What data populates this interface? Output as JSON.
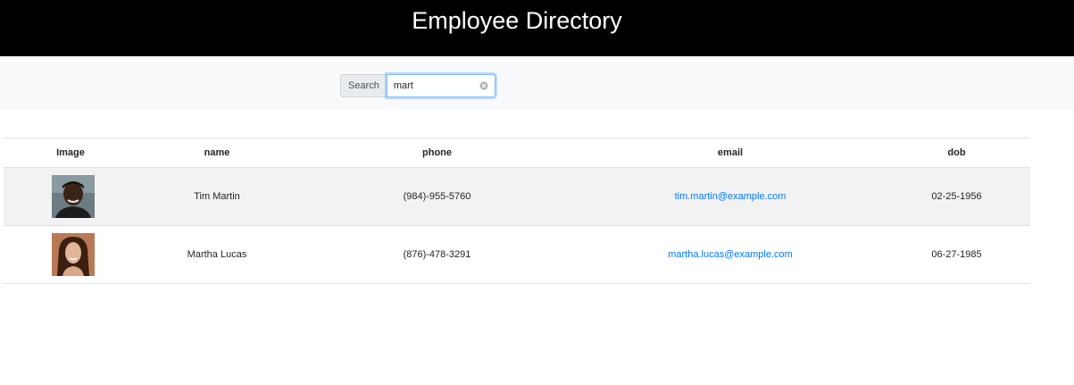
{
  "header": {
    "title": "Employee Directory"
  },
  "search": {
    "label": "Search",
    "value": "mart",
    "clear_icon": "clear-icon"
  },
  "table": {
    "columns": [
      "Image",
      "name",
      "phone",
      "email",
      "dob"
    ],
    "rows": [
      {
        "avatar_icon": "avatar-photo",
        "name": "Tim Martin",
        "phone": "(984)-955-5760",
        "email": "tim.martin@example.com",
        "dob": "02-25-1956"
      },
      {
        "avatar_icon": "avatar-photo",
        "name": "Martha Lucas",
        "phone": "(876)-478-3291",
        "email": "martha.lucas@example.com",
        "dob": "06-27-1985"
      }
    ]
  },
  "colors": {
    "header_bg": "#000000",
    "link": "#007bff",
    "stripe": "#f2f2f2"
  }
}
